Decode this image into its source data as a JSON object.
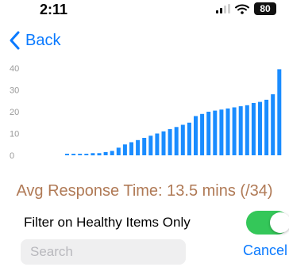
{
  "status_bar": {
    "time": "2:11",
    "battery": "80"
  },
  "nav": {
    "back_label": "Back"
  },
  "chart_data": {
    "type": "bar",
    "yticks": [
      0,
      10,
      20,
      30,
      40
    ],
    "ylim": [
      0,
      40
    ],
    "values": [
      0.7,
      0.7,
      0.7,
      0.7,
      1,
      1,
      1.5,
      2,
      3.5,
      5,
      6,
      7,
      8,
      9,
      10,
      11,
      12,
      13,
      14,
      15,
      18,
      19,
      20,
      20.5,
      21,
      21.5,
      22,
      22.5,
      23,
      24,
      24.5,
      25.5,
      28,
      39.5
    ],
    "bar_color": "#1a8cff"
  },
  "summary": {
    "avg_response": "Avg Response Time: 13.5 mins (/34)"
  },
  "filter": {
    "label": "Filter on Healthy Items Only",
    "enabled": true
  },
  "search": {
    "placeholder": "Search",
    "cancel_label": "Cancel"
  },
  "colors": {
    "accent": "#0a7aff",
    "toggle_on": "#34c759",
    "summary_text": "#b07a56"
  }
}
